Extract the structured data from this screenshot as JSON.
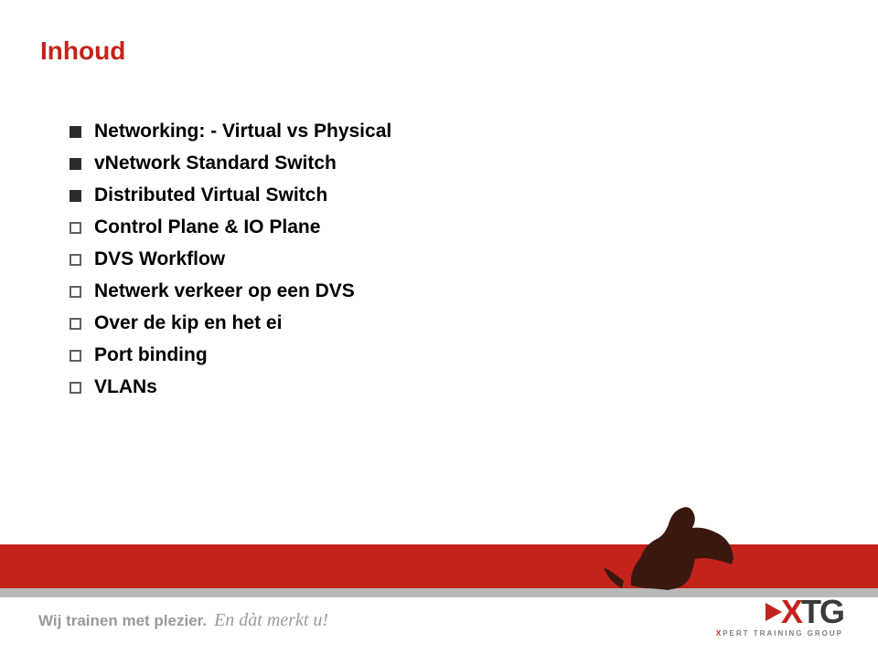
{
  "title": "Inhoud",
  "items": [
    {
      "text": "Networking: - Virtual vs Physical",
      "style": "solid"
    },
    {
      "text": "vNetwork Standard Switch",
      "style": "solid"
    },
    {
      "text": "Distributed Virtual Switch",
      "style": "solid"
    },
    {
      "text": "Control Plane & IO Plane",
      "style": "hollow"
    },
    {
      "text": "DVS Workflow",
      "style": "hollow"
    },
    {
      "text": "Netwerk verkeer op een DVS",
      "style": "hollow"
    },
    {
      "text": "Over de kip en het ei",
      "style": "hollow"
    },
    {
      "text": "Port binding",
      "style": "hollow"
    },
    {
      "text": "VLANs",
      "style": "hollow"
    }
  ],
  "footer": {
    "tagline_bold": "Wij trainen met plezier.",
    "tagline_italic": "En dàt merkt u!",
    "logo_main": "XTG",
    "logo_sub_pre": "X",
    "logo_sub_rest": "PERT TRAINING GROUP"
  }
}
